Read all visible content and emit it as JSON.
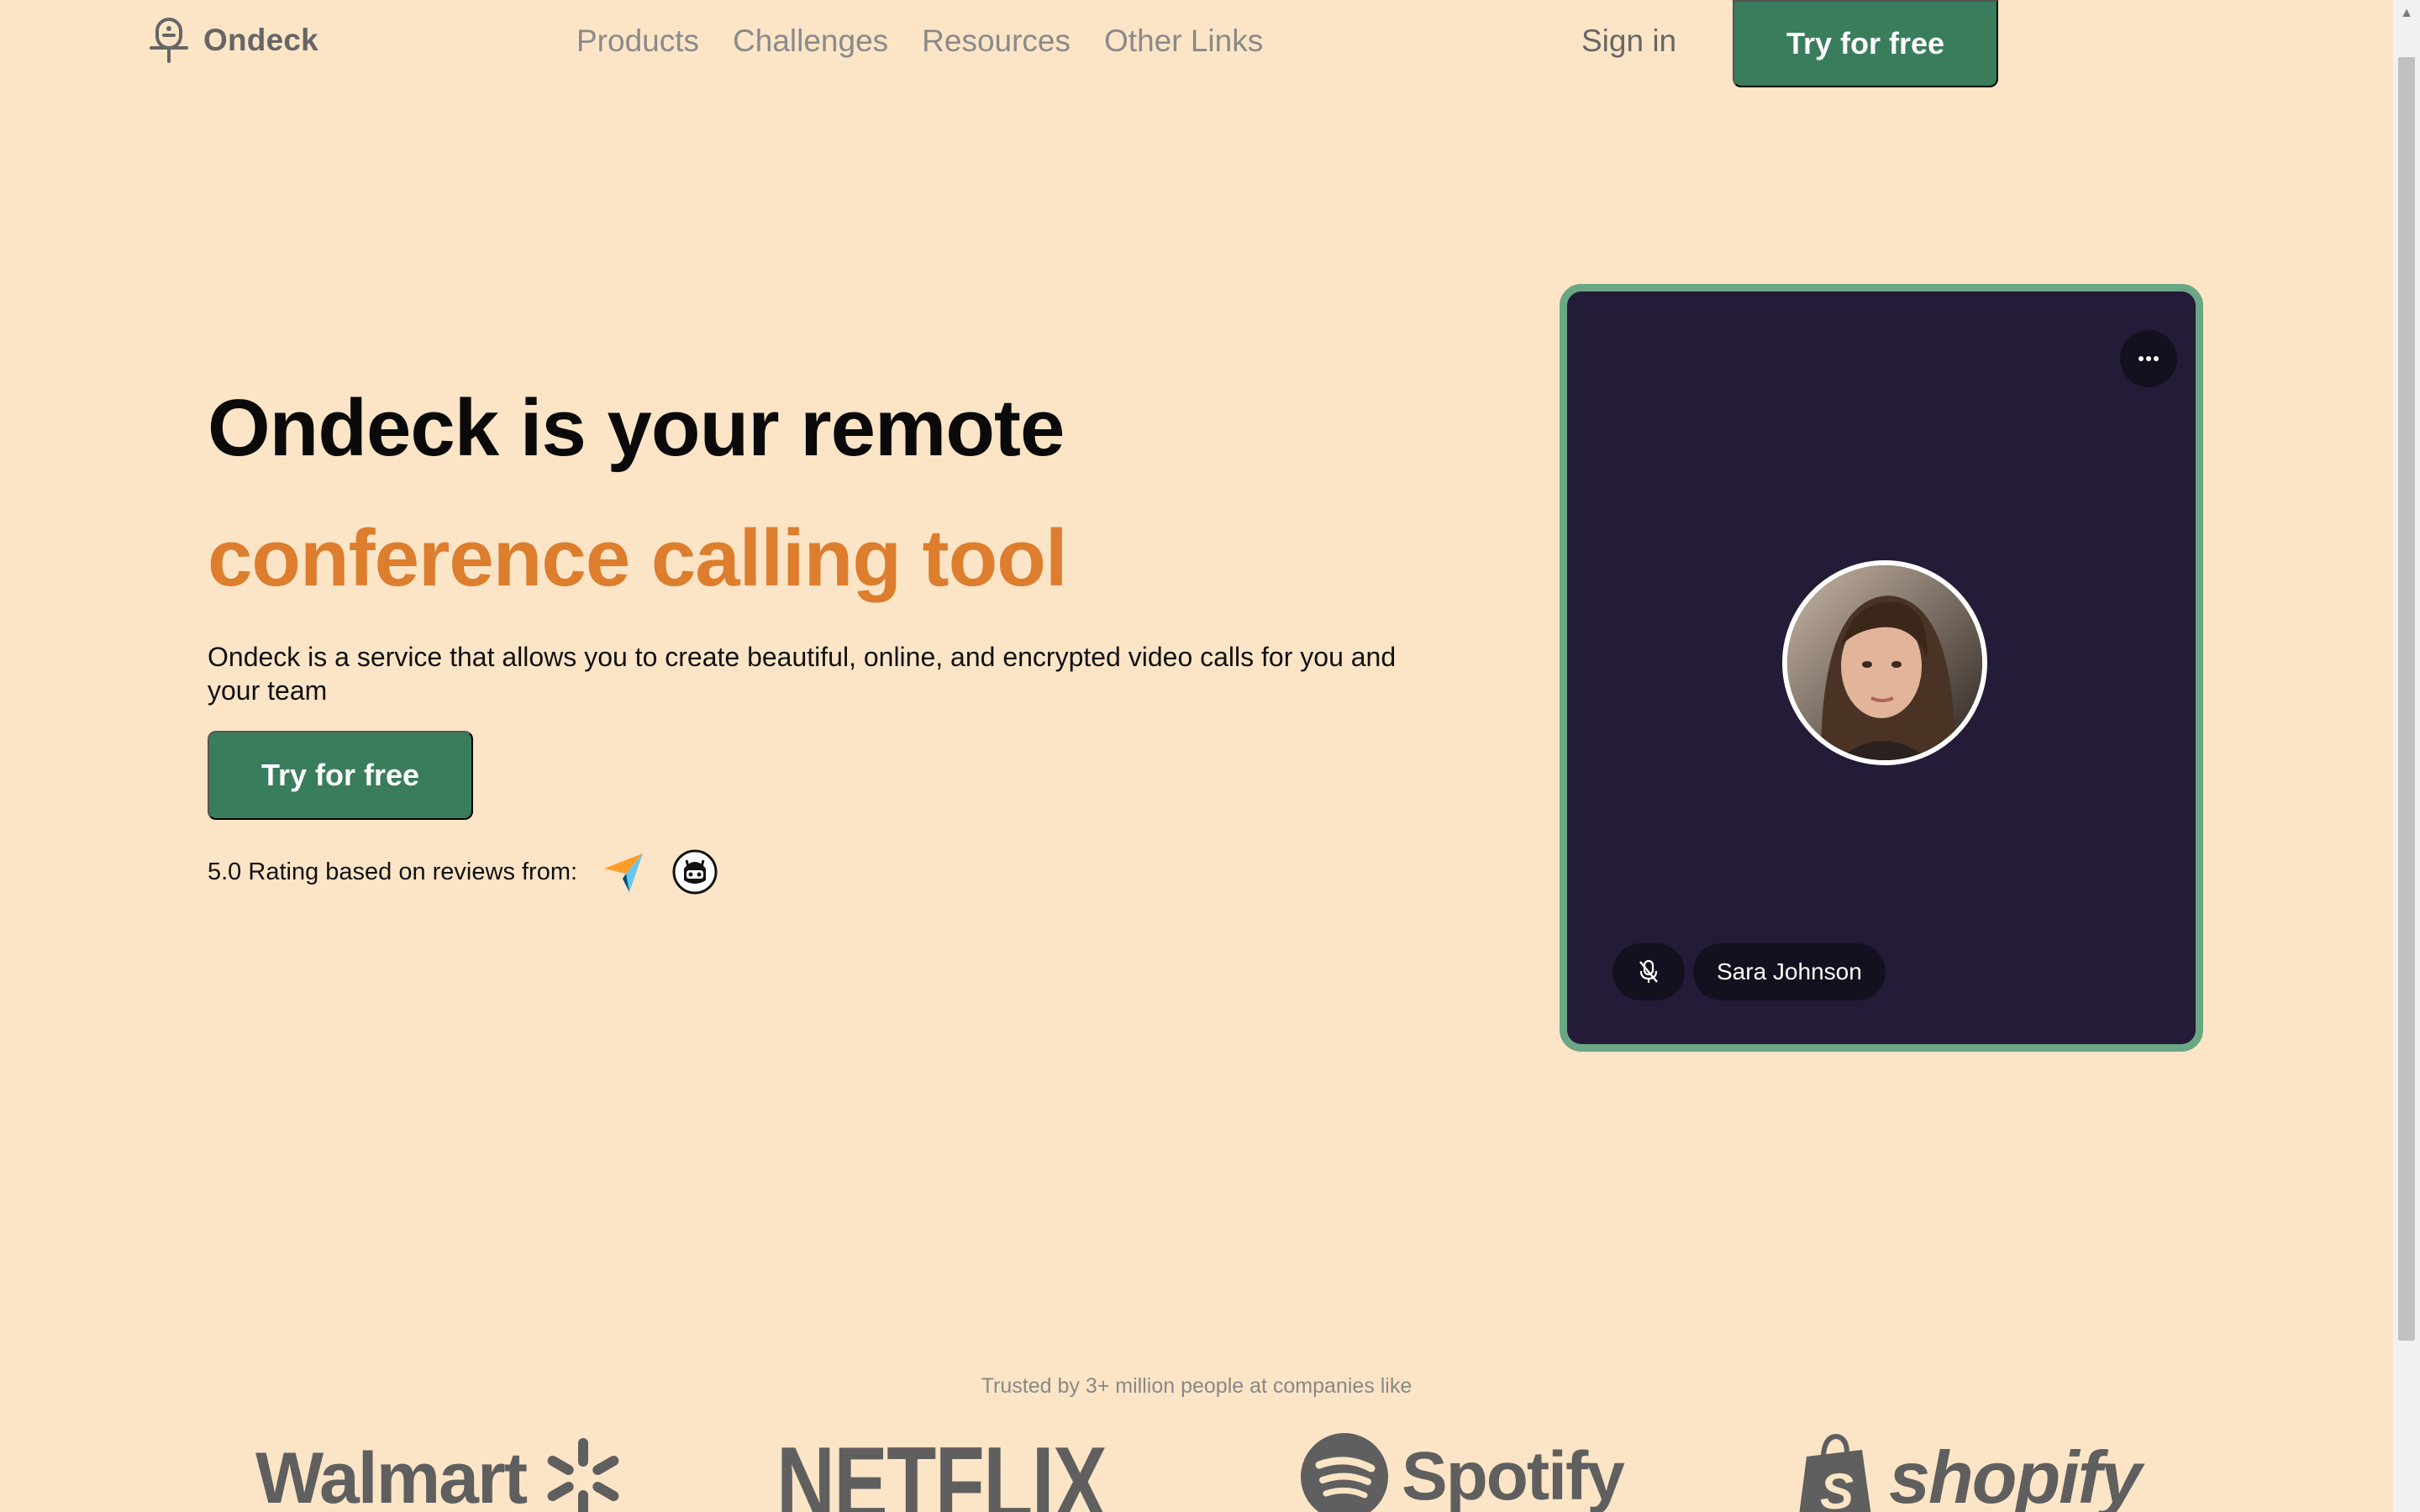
{
  "nav": {
    "brand": "Ondeck",
    "links": [
      "Products",
      "Challenges",
      "Resources",
      "Other Links"
    ],
    "signin": "Sign in",
    "cta": "Try for free"
  },
  "hero": {
    "title": "Ondeck is your remote",
    "title_accent": "conference calling tool",
    "description": "Ondeck is a service that allows you to create beautiful, online, and encrypted video calls for you and your team",
    "cta": "Try for free",
    "rating_text": "5.0 Rating based on reviews from:"
  },
  "video_card": {
    "participant_name": "Sara Johnson",
    "mic_state": "muted"
  },
  "trusted": {
    "text": "Trusted by 3+ million people at companies like",
    "brands": [
      "Walmart",
      "NETFLIX",
      "Spotify",
      "shopify"
    ]
  },
  "colors": {
    "background": "#fce5c6",
    "primary": "#3a7d5c",
    "accent": "#dd7d2e",
    "card": "#231b37",
    "card_border": "#6aa784"
  }
}
